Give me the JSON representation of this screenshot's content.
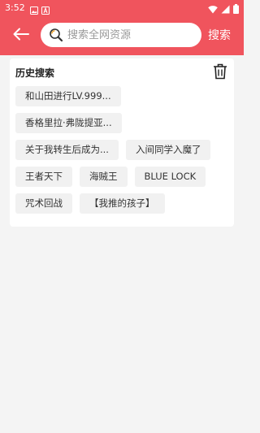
{
  "status_bar": {
    "time": "3:52"
  },
  "header": {
    "back_icon": "arrow-left-icon",
    "search": {
      "placeholder": "搜索全网资源",
      "value": ""
    },
    "search_label": "搜索"
  },
  "history": {
    "title": "历史搜索",
    "delete_icon": "trash-icon",
    "rows": [
      [
        "和山田进行LV.999..."
      ],
      [
        "香格里拉·弗陇提亚..."
      ],
      [
        "关于我转生后成为...",
        "入间同学入魔了"
      ],
      [
        "王者天下",
        "海贼王",
        "BLUE LOCK"
      ],
      [
        "咒术回战",
        "【我推的孩子】"
      ]
    ]
  },
  "colors": {
    "brand": "#f0545d",
    "tag_bg": "#f1f1f1",
    "page_bg": "#f4f4f4"
  }
}
